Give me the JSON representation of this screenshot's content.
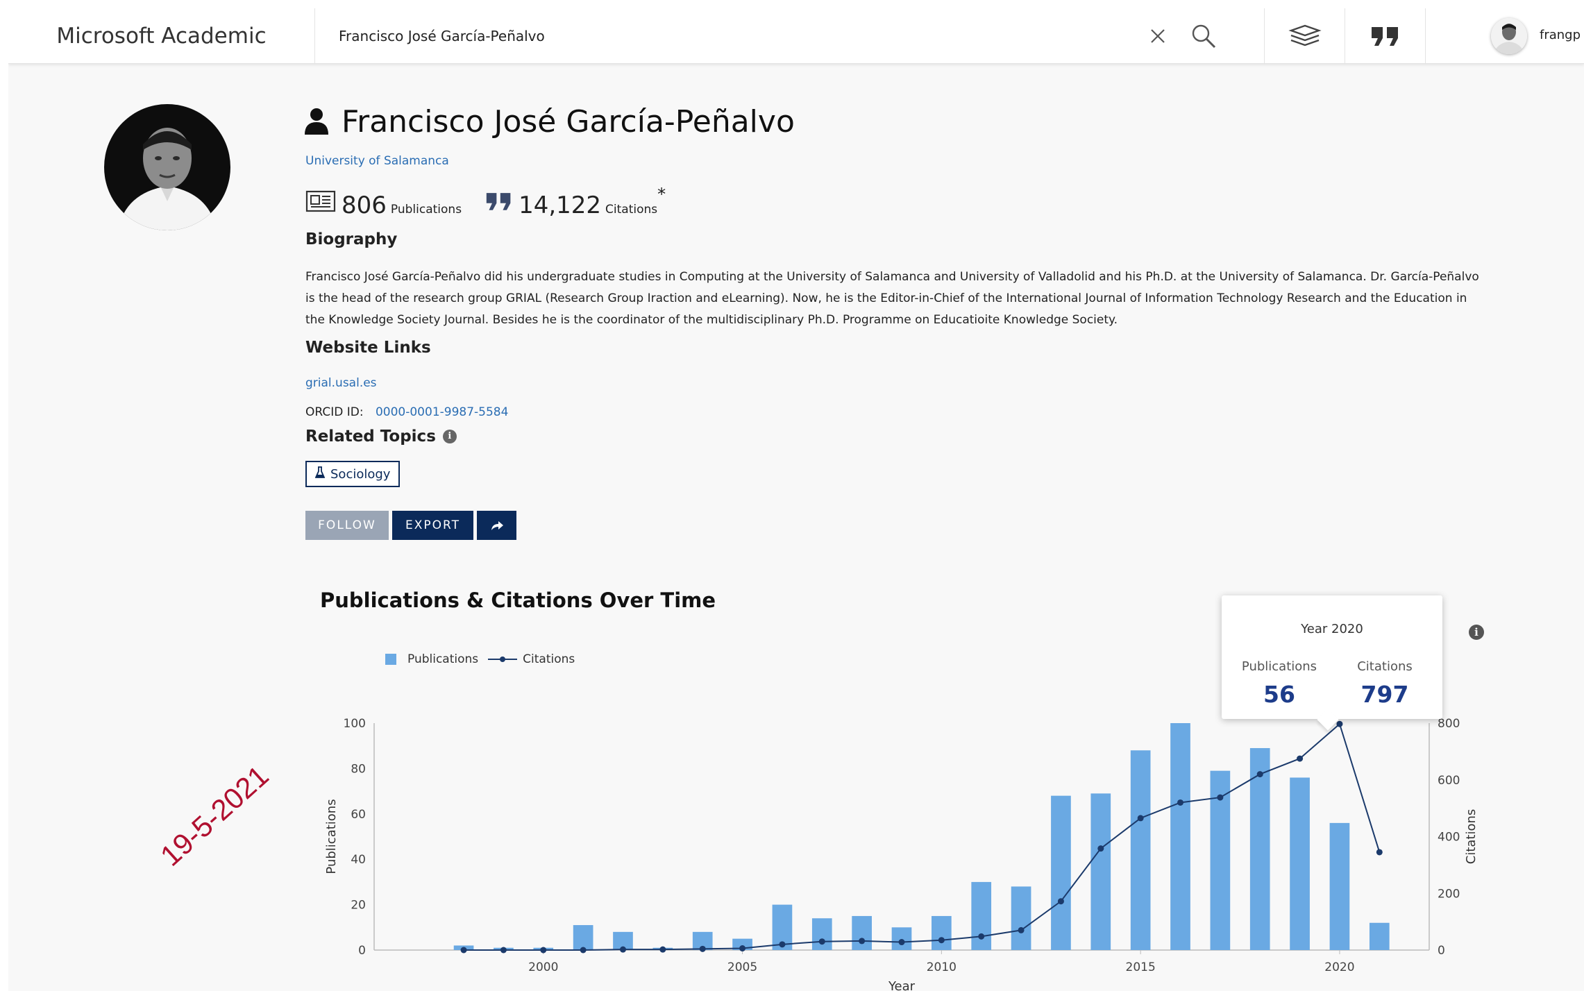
{
  "header": {
    "brand": "Microsoft Academic",
    "search_value": "Francisco José García-Peñalvo",
    "username": "frangp"
  },
  "profile": {
    "name": "Francisco José García-Peñalvo",
    "affiliation": "University of Salamanca",
    "publications_count": "806",
    "publications_label": "Publications",
    "citations_count": "14,122",
    "citations_label": "Citations",
    "citations_mark": "*",
    "biography_heading": "Biography",
    "biography": "Francisco José García-Peñalvo did his undergraduate studies in Computing at the University of Salamanca and University of Valladolid and his Ph.D. at the University of Salamanca. Dr. García-Peñalvo is the head of the research group GRIAL (Research Group Iraction and eLearning). Now, he is the Editor-in-Chief of the International Journal of Information Technology Research and the Education in the Knowledge Society Journal. Besides he is the coordinator of the multidisciplinary Ph.D. Programme on Educatioite Knowledge Society.",
    "website_heading": "Website Links",
    "website": "grial.usal.es",
    "orcid_label": "ORCID ID:",
    "orcid": "0000-0001-9987-5584",
    "topics_heading": "Related Topics",
    "topics": [
      "Sociology"
    ],
    "buttons": {
      "follow": "FOLLOW",
      "export": "EXPORT"
    }
  },
  "stamp": "19-5-2021",
  "tooltip": {
    "year": "Year 2020",
    "publications_label": "Publications",
    "publications_value": "56",
    "citations_label": "Citations",
    "citations_value": "797"
  },
  "chart_data": {
    "type": "bar",
    "title": "Publications & Citations Over Time",
    "xlabel": "Year",
    "ylabel": "Publications",
    "ylabel_right": "Citations",
    "x": [
      1998,
      1999,
      2000,
      2001,
      2002,
      2003,
      2004,
      2005,
      2006,
      2007,
      2008,
      2009,
      2010,
      2011,
      2012,
      2013,
      2014,
      2015,
      2016,
      2017,
      2018,
      2019,
      2020,
      2021
    ],
    "x_ticks": [
      2000,
      2005,
      2010,
      2015,
      2020
    ],
    "ylim": [
      0,
      100
    ],
    "y_ticks": [
      0,
      20,
      40,
      60,
      80,
      100
    ],
    "ylim_right": [
      0,
      800
    ],
    "y_ticks_right": [
      0,
      200,
      400,
      600,
      800
    ],
    "grid": false,
    "legend": "top-left",
    "series": [
      {
        "name": "Publications",
        "kind": "bar",
        "axis": "left",
        "color": "#6aa9e3",
        "values": [
          2,
          1,
          1,
          11,
          8,
          1,
          8,
          5,
          20,
          14,
          15,
          10,
          15,
          30,
          28,
          68,
          69,
          88,
          100,
          79,
          89,
          76,
          56,
          12
        ]
      },
      {
        "name": "Citations",
        "kind": "line",
        "axis": "right",
        "color": "#1b3a6b",
        "values": [
          0,
          0,
          0,
          0,
          2,
          2,
          4,
          6,
          20,
          30,
          32,
          28,
          35,
          48,
          70,
          172,
          358,
          465,
          520,
          538,
          620,
          675,
          797,
          345
        ]
      }
    ]
  }
}
